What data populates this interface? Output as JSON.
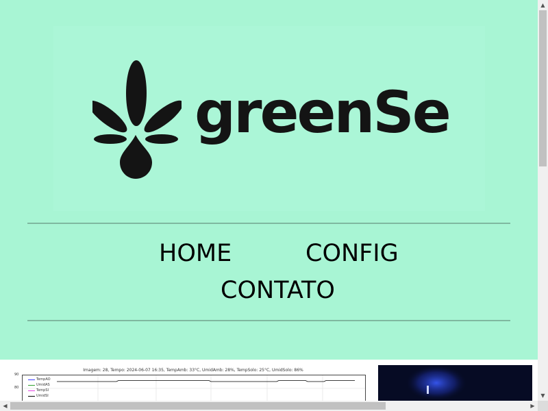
{
  "brand": {
    "name": "greenSe"
  },
  "nav": {
    "home": "HOME",
    "config": "CONFIG",
    "contato": "CONTATO"
  },
  "chart_data": {
    "type": "line",
    "title": "Imagem: 28, Tempo: 2024-06-07 16:35, TempAmb: 33°C, UmidAmb: 28%, TempSolo: 25°C, UmidSolo: 86%",
    "yticks": [
      "90",
      "80"
    ],
    "legend": [
      "TempAO",
      "UmidAS",
      "TempSI",
      "UmidSI"
    ],
    "series": [
      {
        "name": "TempAO",
        "color": "#3a3aff"
      },
      {
        "name": "UmidAS",
        "color": "#2ca02c"
      },
      {
        "name": "TempSI",
        "color": "#e040e0"
      },
      {
        "name": "UmidSI",
        "color": "#000000"
      }
    ]
  },
  "scrollbars": {
    "up": "▲",
    "down": "▼",
    "left": "◀",
    "right": "▶"
  }
}
